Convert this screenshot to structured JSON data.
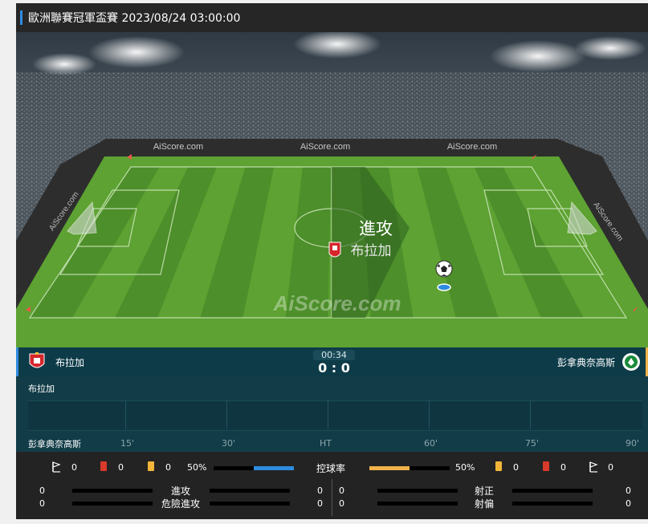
{
  "header": {
    "title": "歐洲聯賽冠軍盃賽 2023/08/24 03:00:00"
  },
  "pitch": {
    "watermark": "AiScore.com",
    "board_labels": [
      "AiScore.com",
      "AiScore.com",
      "AiScore.com"
    ],
    "side_labels": [
      "AiScore.com",
      "AiScore.com"
    ],
    "event_label": "進攻",
    "event_team": "布拉加",
    "ball_icon": "soccer-ball-icon"
  },
  "match": {
    "home_team": "布拉加",
    "away_team": "彭拿典奈高斯",
    "clock": "00:34",
    "score": "0 : 0",
    "colors": {
      "home_accent": "#2f8be0",
      "away_accent": "#f0b24a"
    }
  },
  "timeline": {
    "home_label": "布拉加",
    "away_label": "彭拿典奈高斯",
    "ticks": [
      "15'",
      "30'",
      "HT",
      "60'",
      "75'",
      "90'"
    ]
  },
  "stats": {
    "home_corners": "0",
    "home_red": "0",
    "home_yellow": "0",
    "home_possession": "50%",
    "possession_label": "控球率",
    "away_possession": "50%",
    "away_yellow": "0",
    "away_red": "0",
    "away_corners": "0",
    "possession_home_fraction": 0.5,
    "possession_away_fraction": 0.5,
    "left": [
      {
        "label": "進攻",
        "home": "0",
        "away": "0"
      },
      {
        "label": "危險進攻",
        "home": "0",
        "away": "0"
      }
    ],
    "right": [
      {
        "label": "射正",
        "home": "0",
        "away": "0"
      },
      {
        "label": "射偏",
        "home": "0",
        "away": "0"
      }
    ]
  }
}
